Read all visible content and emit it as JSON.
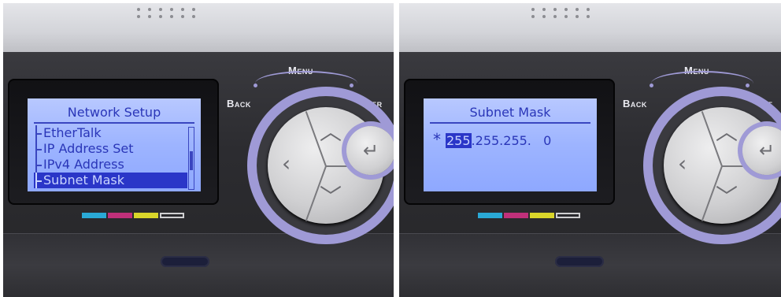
{
  "left_photo": {
    "lcd": {
      "title": "Network Setup",
      "items": [
        "EtherTalk",
        "IP Address Set",
        "IPv4 Address",
        "Subnet Mask"
      ],
      "selected_index": 3,
      "scroll_position": 0.55
    },
    "labels": {
      "menu": "Menu",
      "back": "Back",
      "enter": "Enter"
    }
  },
  "right_photo": {
    "lcd": {
      "title": "Subnet Mask",
      "marker": "*",
      "octet_selected": "255",
      "octet_rest": ".255.255.   0"
    },
    "labels": {
      "menu": "Menu",
      "back": "Back",
      "enter": "Ente"
    }
  },
  "colors": {
    "lcd_text": "#2a36b8",
    "lcd_background": "#9db4ff",
    "ring_accent": "#9f9ad6",
    "color_swatches": [
      "#2aa9d6",
      "#c0307a",
      "#d9d52a",
      "#2a2a2e"
    ]
  },
  "icons": {
    "up": "▲",
    "down": "▼",
    "left": "‹",
    "enter": "↵"
  }
}
